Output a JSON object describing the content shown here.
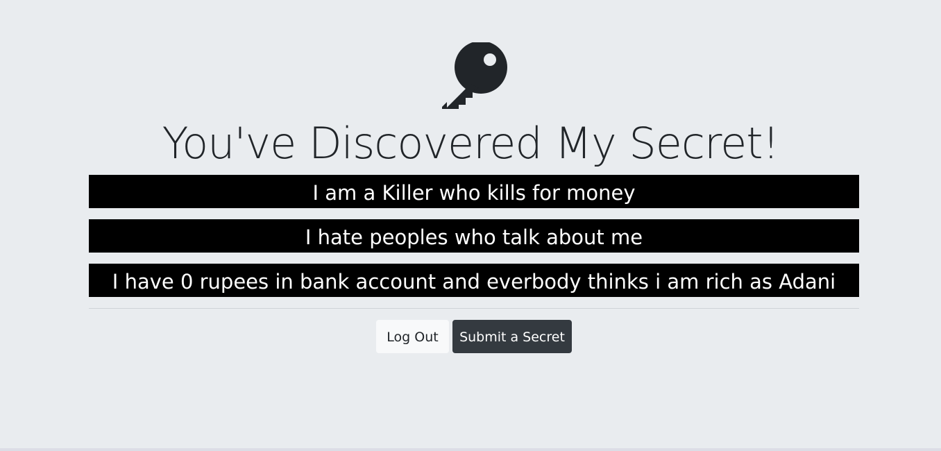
{
  "header": {
    "icon": "key-icon",
    "title": "You've Discovered My Secret!"
  },
  "secrets": [
    "I am a Killer who kills for money",
    "I hate peoples who talk about me",
    "I have 0 rupees in bank account and everbody thinks i am rich as Adani"
  ],
  "actions": {
    "logout_label": "Log Out",
    "submit_label": "Submit a Secret"
  },
  "colors": {
    "page_background": "#e9ecef",
    "secret_background": "#000000",
    "secret_text": "#ffffff",
    "logout_button": "#f8f9fa",
    "submit_button": "#343a40"
  }
}
